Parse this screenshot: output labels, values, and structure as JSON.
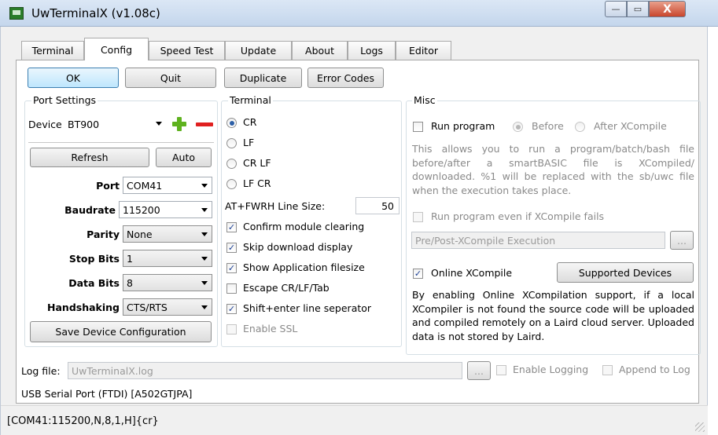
{
  "window": {
    "title": "UwTerminalX (v1.08c)",
    "min": "—",
    "max": "▭",
    "close": "X"
  },
  "tabs": [
    "Terminal",
    "Config",
    "Speed Test",
    "Update",
    "About",
    "Logs",
    "Editor"
  ],
  "active_tab": "Config",
  "actions": {
    "ok": "OK",
    "quit": "Quit",
    "duplicate": "Duplicate",
    "error_codes": "Error Codes"
  },
  "port_settings": {
    "title": "Port Settings",
    "device_label": "Device",
    "device_value": "BT900",
    "refresh": "Refresh",
    "auto": "Auto",
    "port_label": "Port",
    "port_value": "COM41",
    "baud_label": "Baudrate",
    "baud_value": "115200",
    "parity_label": "Parity",
    "parity_value": "None",
    "stop_label": "Stop Bits",
    "stop_value": "1",
    "data_label": "Data Bits",
    "data_value": "8",
    "hand_label": "Handshaking",
    "hand_value": "CTS/RTS",
    "save": "Save Device Configuration"
  },
  "terminal": {
    "title": "Terminal",
    "radios": [
      "CR",
      "LF",
      "CR LF",
      "LF CR"
    ],
    "selected_radio": "CR",
    "line_size_label": "AT+FWRH Line Size:",
    "line_size_value": "50",
    "checks": [
      {
        "label": "Confirm module clearing",
        "checked": true
      },
      {
        "label": "Skip download display",
        "checked": true
      },
      {
        "label": "Show Application filesize",
        "checked": true
      },
      {
        "label": "Escape CR/LF/Tab",
        "checked": false
      },
      {
        "label": "Shift+enter line seperator",
        "checked": true
      },
      {
        "label": "Enable SSL",
        "checked": false,
        "disabled": true
      }
    ]
  },
  "misc": {
    "title": "Misc",
    "run_program": "Run program",
    "before": "Before",
    "after": "After XCompile",
    "desc1": "This allows you to run a program/batch/bash file before/after a smartBASIC file is XCompiled/ downloaded. %1 will be replaced with the sb/uwc file when the execution takes place.",
    "run_even": "Run program even if XCompile fails",
    "exec_placeholder": "Pre/Post-XCompile Execution",
    "browse": "...",
    "online_xcompile": "Online XCompile",
    "supported_devices": "Supported Devices",
    "desc2": "By enabling Online XCompilation support, if a local XCompiler is not found the source code will be uploaded and compiled remotely on a Laird cloud server. Uploaded data is not stored by Laird."
  },
  "log": {
    "label": "Log file:",
    "value": "UwTerminalX.log",
    "browse": "...",
    "enable": "Enable Logging",
    "append": "Append to Log"
  },
  "device_info": "USB Serial Port (FTDI) [A502GTJPA]",
  "status": "[COM41:115200,N,8,1,H]{cr}"
}
